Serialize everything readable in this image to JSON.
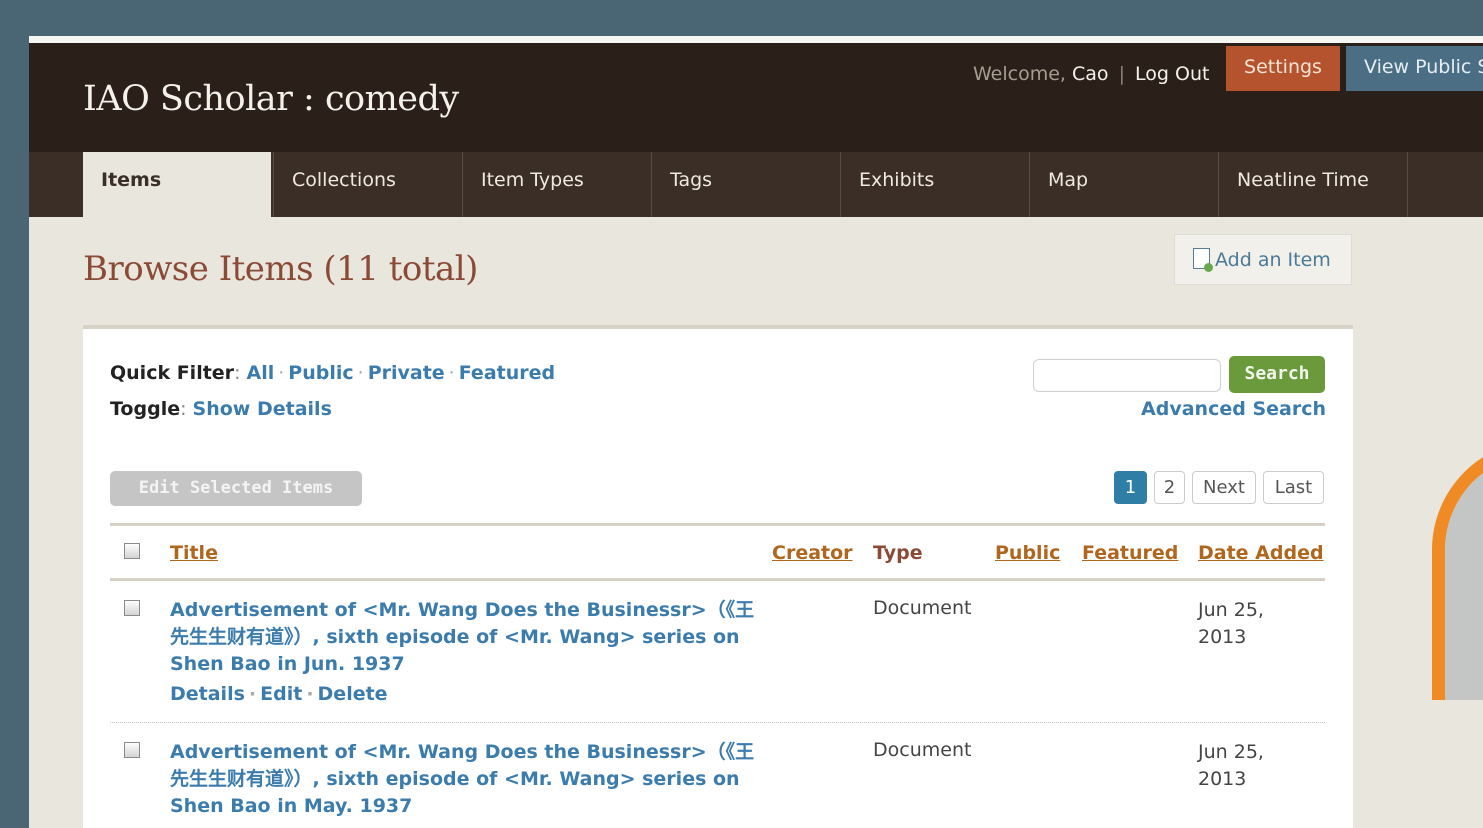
{
  "header": {
    "site_title": "IAO Scholar : comedy",
    "welcome_text": "Welcome,",
    "user_name": "Cao",
    "separator": "|",
    "logout_label": "Log Out",
    "settings_label": "Settings",
    "view_public_label": "View Public S"
  },
  "nav": {
    "tabs": [
      {
        "label": "Items",
        "active": true
      },
      {
        "label": "Collections"
      },
      {
        "label": "Item Types"
      },
      {
        "label": "Tags"
      },
      {
        "label": "Exhibits"
      },
      {
        "label": "Map"
      },
      {
        "label": "Neatline Time"
      }
    ]
  },
  "page": {
    "title": "Browse Items (11 total)",
    "add_item_label": "Add an Item"
  },
  "filters": {
    "quick_filter_label": "Quick Filter",
    "options": [
      "All",
      "Public",
      "Private",
      "Featured"
    ],
    "toggle_label": "Toggle",
    "toggle_value": "Show Details"
  },
  "search": {
    "input_value": "",
    "button_label": "Search",
    "advanced_label": "Advanced Search"
  },
  "bulk": {
    "edit_selected_label": "Edit Selected Items"
  },
  "pagination": {
    "pages": [
      "1",
      "2"
    ],
    "current": "1",
    "next_label": "Next",
    "last_label": "Last"
  },
  "table": {
    "columns": {
      "title": "Title",
      "creator": "Creator",
      "type": "Type",
      "public": "Public",
      "featured": "Featured",
      "date_added": "Date Added"
    },
    "rows": [
      {
        "title": "Advertisement of <Mr. Wang Does the Businessr>（《王先生生财有道》）, sixth episode of <Mr. Wang> series on Shen Bao in Jun. 1937",
        "type": "Document",
        "date_added": "Jun 25, 2013",
        "actions": [
          "Details",
          "Edit",
          "Delete"
        ]
      },
      {
        "title": "Advertisement of <Mr. Wang Does the Businessr>（《王先生生财有道》）, sixth episode of <Mr. Wang> series on Shen Bao in May. 1937",
        "type": "Document",
        "date_added": "Jun 25, 2013"
      }
    ]
  },
  "colors": {
    "header_bg": "#2b2019",
    "nav_bg": "#3a2e26",
    "settings_bg": "#b5532f",
    "view_public_bg": "#4b6e85",
    "link": "#3b7cad",
    "sort_link": "#b0661c",
    "title": "#8b4a36",
    "search_btn": "#6a9a3c",
    "page_current": "#2f7ea6",
    "deco_arc": "#f08a25"
  }
}
